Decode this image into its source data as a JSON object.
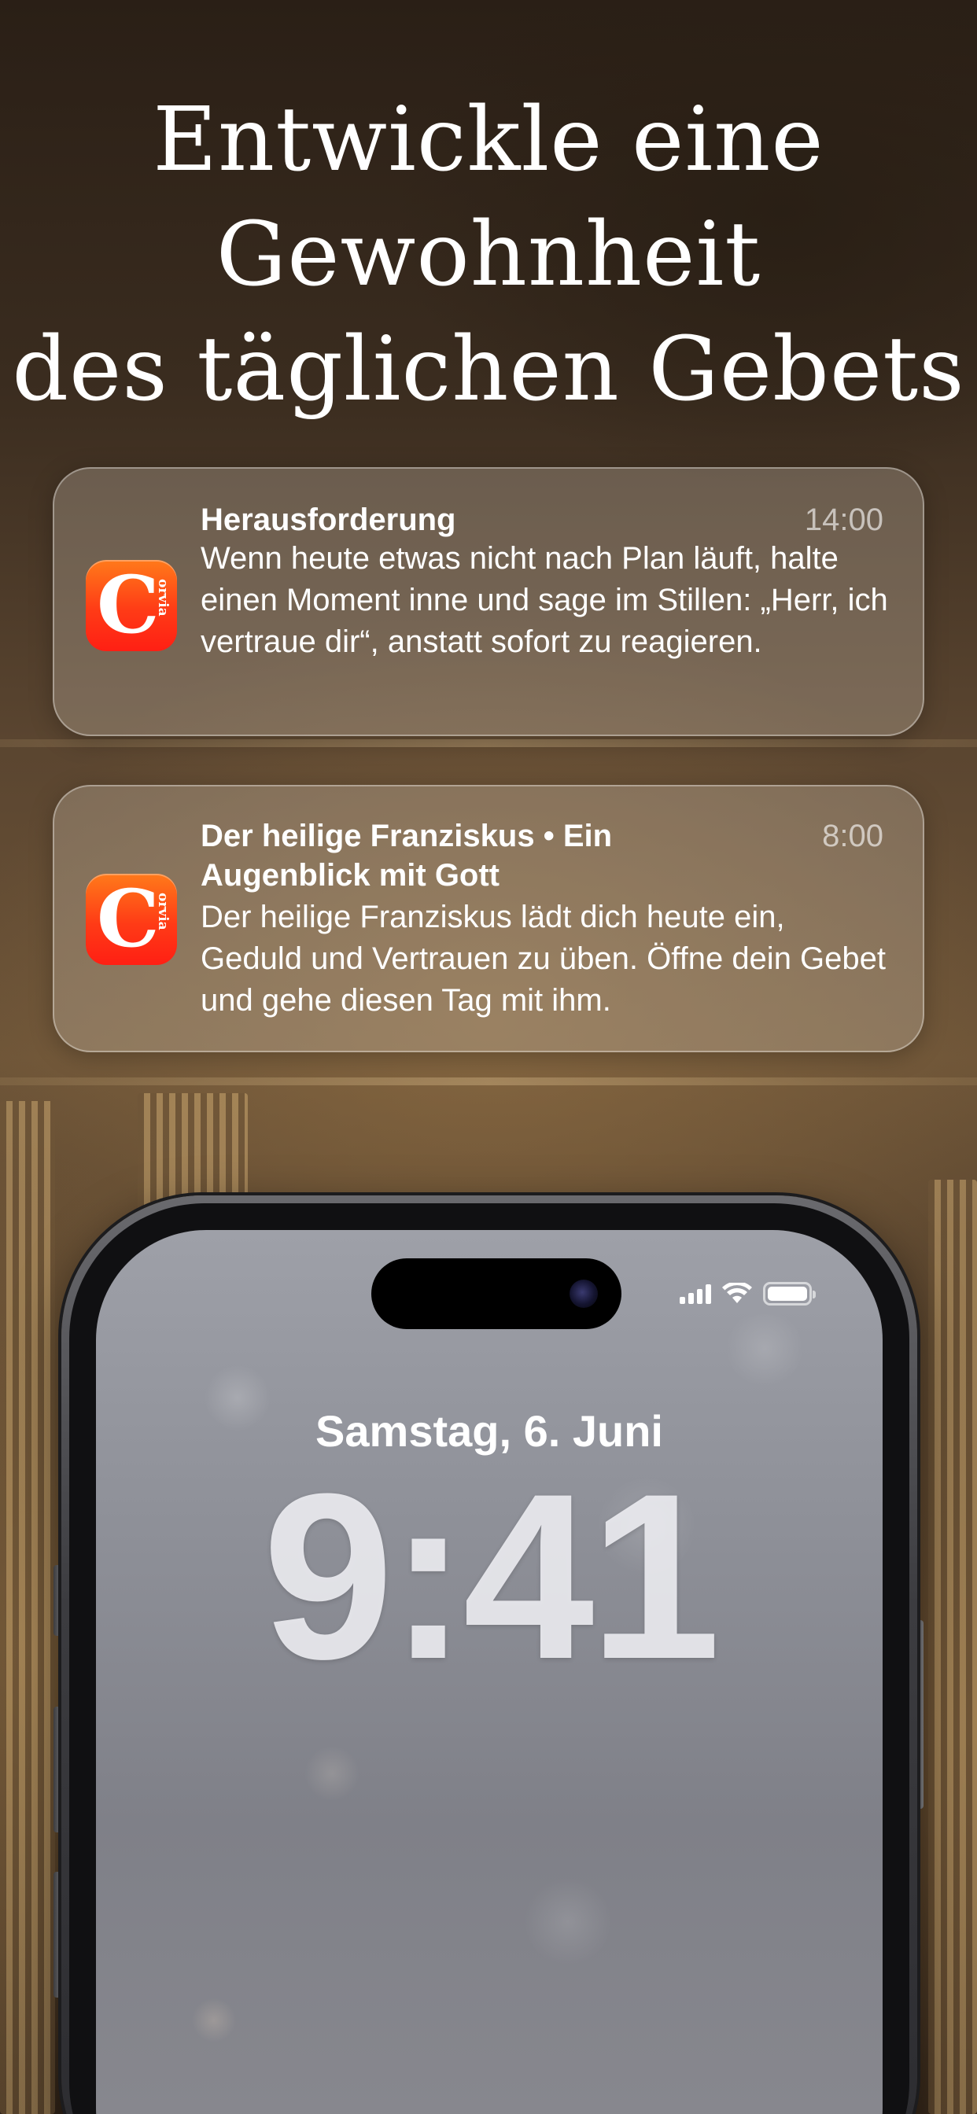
{
  "headline": {
    "line1": "Entwickle eine",
    "line2": "Gewohnheit",
    "line3": "des täglichen Gebets"
  },
  "notifications": [
    {
      "app_icon": "corvia-app-icon",
      "icon_letter": "C",
      "icon_text": "orvia",
      "title": "Herausforderung",
      "time": "14:00",
      "body": "Wenn heute etwas nicht nach Plan läuft, halte einen Moment inne und sage im Stillen: „Herr, ich vertraue dir“, anstatt sofort zu reagieren."
    },
    {
      "app_icon": "corvia-app-icon",
      "icon_letter": "C",
      "icon_text": "orvia",
      "title": "Der heilige Franziskus • Ein Augenblick mit Gott",
      "time": "8:00",
      "body": "Der heilige Franziskus lädt dich heute ein, Geduld und Vertrauen zu üben. Öffne dein Gebet und gehe diesen Tag mit ihm."
    }
  ],
  "lock_screen": {
    "date": "Samstag, 6. Juni",
    "time": "9:41",
    "status_icons": [
      "cellular-signal-icon",
      "wifi-icon",
      "battery-icon"
    ],
    "battery_level": 1.0
  },
  "colors": {
    "icon_gradient_top": "#ff7a1a",
    "icon_gradient_bottom": "#ff1f14",
    "text": "#ffffff"
  }
}
